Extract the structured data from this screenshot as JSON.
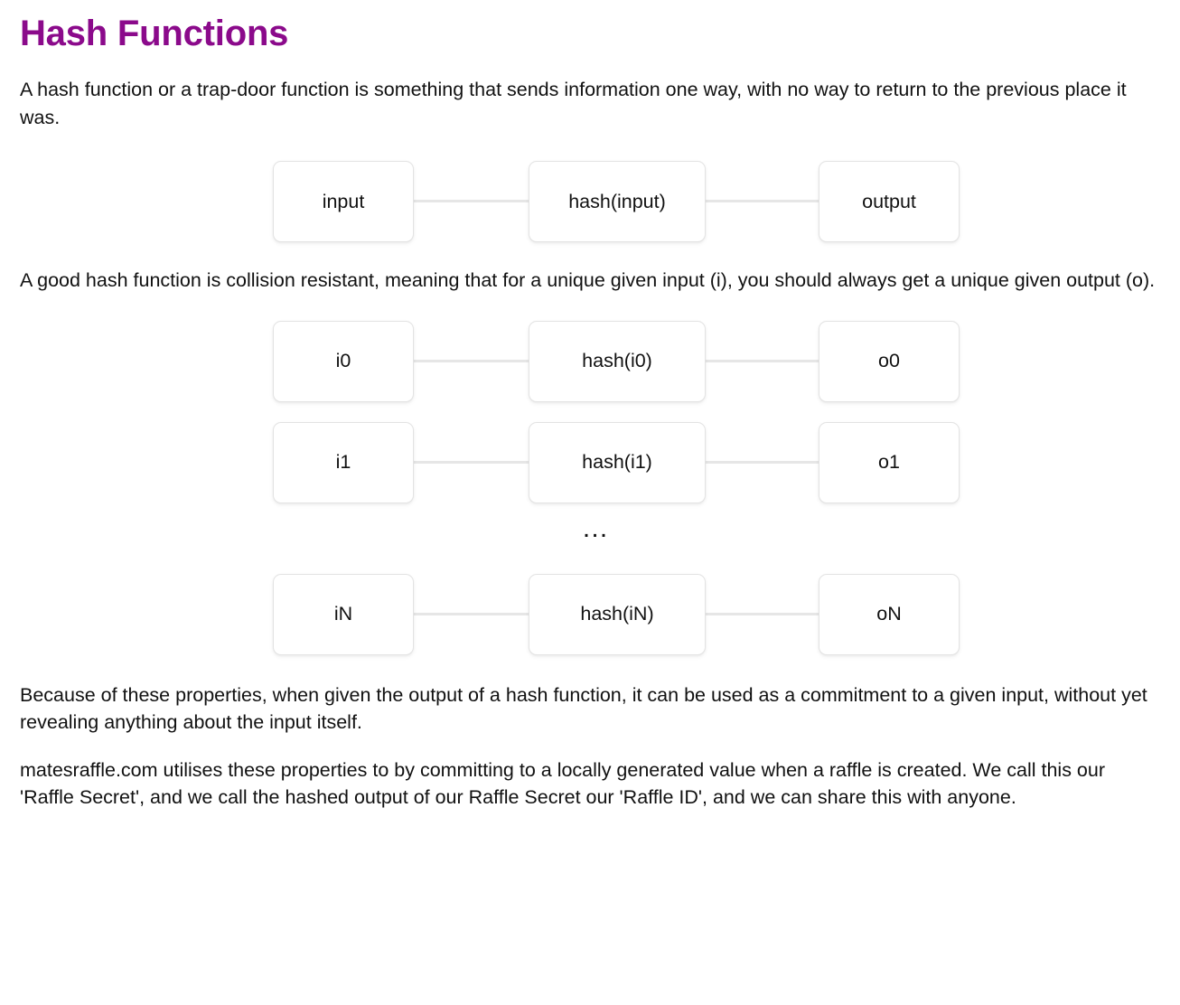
{
  "page": {
    "title": "Hash Functions",
    "title_color": "#8b0a8b",
    "background": "#ffffff",
    "text_color": "#111111"
  },
  "paragraphs": {
    "intro": "A hash function or a trap-door function is something that sends information one way, with no way to return to the previous place it was.",
    "collision": "A good hash function is collision resistant, meaning that for a unique given input (i), you should always get a unique given output (o).",
    "commitment": "Because of these properties, when given the output of a hash function, it can be used as a commitment to a given input, without yet revealing anything about the input itself.",
    "matesraffle": "matesraffle.com utilises these properties to by committing to a locally generated value when a raffle is created. We call this our 'Raffle Secret', and we call the hashed output of our Raffle Secret our 'Raffle ID', and we can share this with anyone."
  },
  "diagram_one": {
    "rows": [
      {
        "input": "input",
        "hash": "hash(input)",
        "output": "output"
      }
    ]
  },
  "diagram_two": {
    "rows_top": [
      {
        "input": "i0",
        "hash": "hash(i0)",
        "output": "o0"
      },
      {
        "input": "i1",
        "hash": "hash(i1)",
        "output": "o1"
      }
    ],
    "ellipsis": "…",
    "rows_bottom": [
      {
        "input": "iN",
        "hash": "hash(iN)",
        "output": "oN"
      }
    ]
  },
  "style": {
    "node_border": "#e3e3e3",
    "connector_color": "#e6e6e6"
  }
}
